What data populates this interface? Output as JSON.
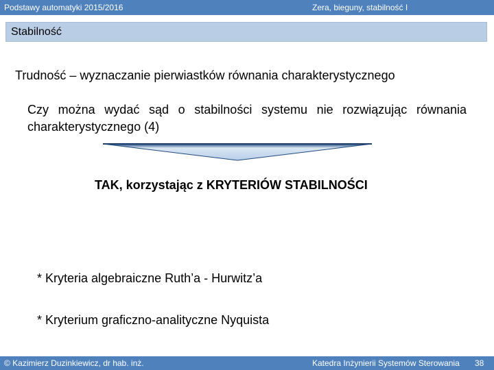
{
  "header": {
    "course": "Podstawy automatyki 2015/2016",
    "topic": "Zera, bieguny, stabilność I"
  },
  "slide": {
    "title": "Stabilność",
    "heading": "Trudność – wyznaczanie pierwiastków równania charakterystycznego",
    "question": "Czy można wydać sąd o stabilności systemu nie rozwiązując równania charakterystycznego (4)",
    "answer": "TAK, korzystając z KRYTERIÓW STABILNOŚCI",
    "criteria": [
      "* Kryteria algebraiczne Ruth’a - Hurwitz’a",
      "* Kryterium graficzno-analityczne Nyquista"
    ]
  },
  "footer": {
    "author": "© Kazimierz Duzinkiewicz, dr hab. inż.",
    "department": "Katedra Inżynierii Systemów Sterowania",
    "page_number": "38"
  },
  "colors": {
    "bar": "#4f81bd",
    "title_box": "#b9cde5",
    "arrow_light": "#c6d9f1",
    "arrow_dark": "#1f497d"
  },
  "icons": {
    "arrow": "down-arrow-icon"
  }
}
